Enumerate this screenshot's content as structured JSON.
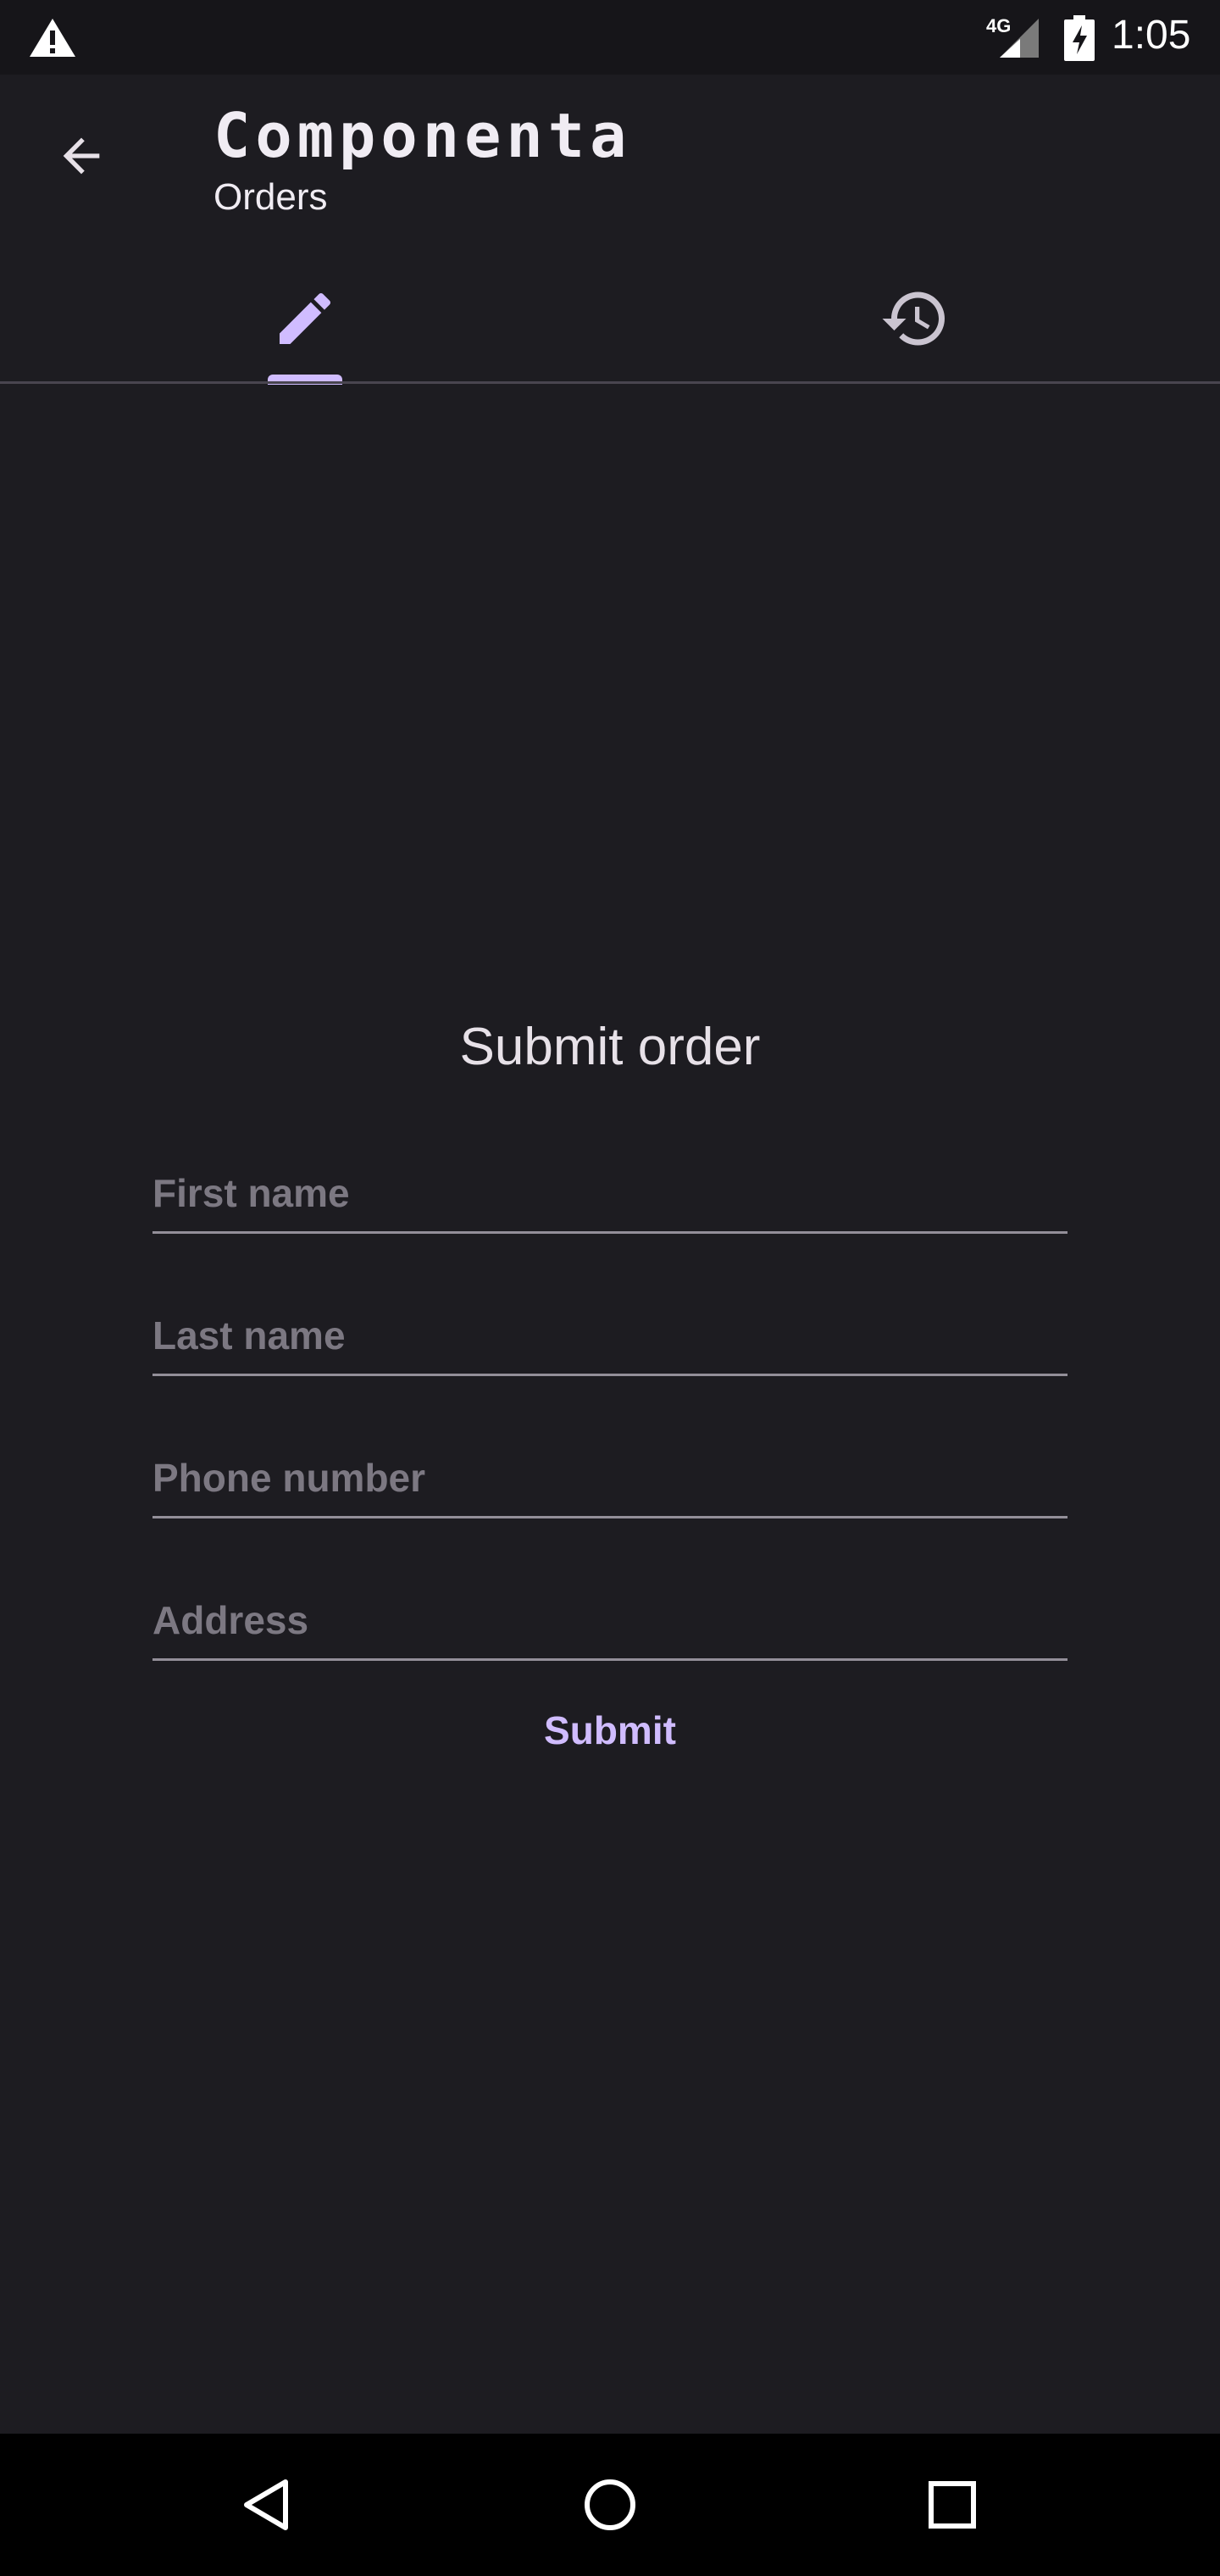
{
  "status_bar": {
    "time": "1:05",
    "network": "4G",
    "icons": [
      "warning-icon",
      "signal-icon",
      "battery-charging-icon"
    ]
  },
  "app_bar": {
    "title": "Componenta",
    "subtitle": "Orders",
    "back_icon": "arrow-back-icon"
  },
  "tabs": [
    {
      "icon": "pencil-icon",
      "selected": true
    },
    {
      "icon": "history-icon",
      "selected": false
    }
  ],
  "form": {
    "title": "Submit order",
    "fields": [
      {
        "placeholder": "First name",
        "value": ""
      },
      {
        "placeholder": "Last name",
        "value": ""
      },
      {
        "placeholder": "Phone number",
        "value": ""
      },
      {
        "placeholder": "Address",
        "value": ""
      }
    ],
    "submit_label": "Submit"
  },
  "nav_bar": {
    "icons": [
      "nav-back-icon",
      "nav-home-icon",
      "nav-recents-icon"
    ]
  },
  "colors": {
    "background": "#1d1c21",
    "accent": "#d0bcff",
    "status_bar": "#161519",
    "nav_bar": "#000000",
    "field_underline": "#938f99"
  }
}
